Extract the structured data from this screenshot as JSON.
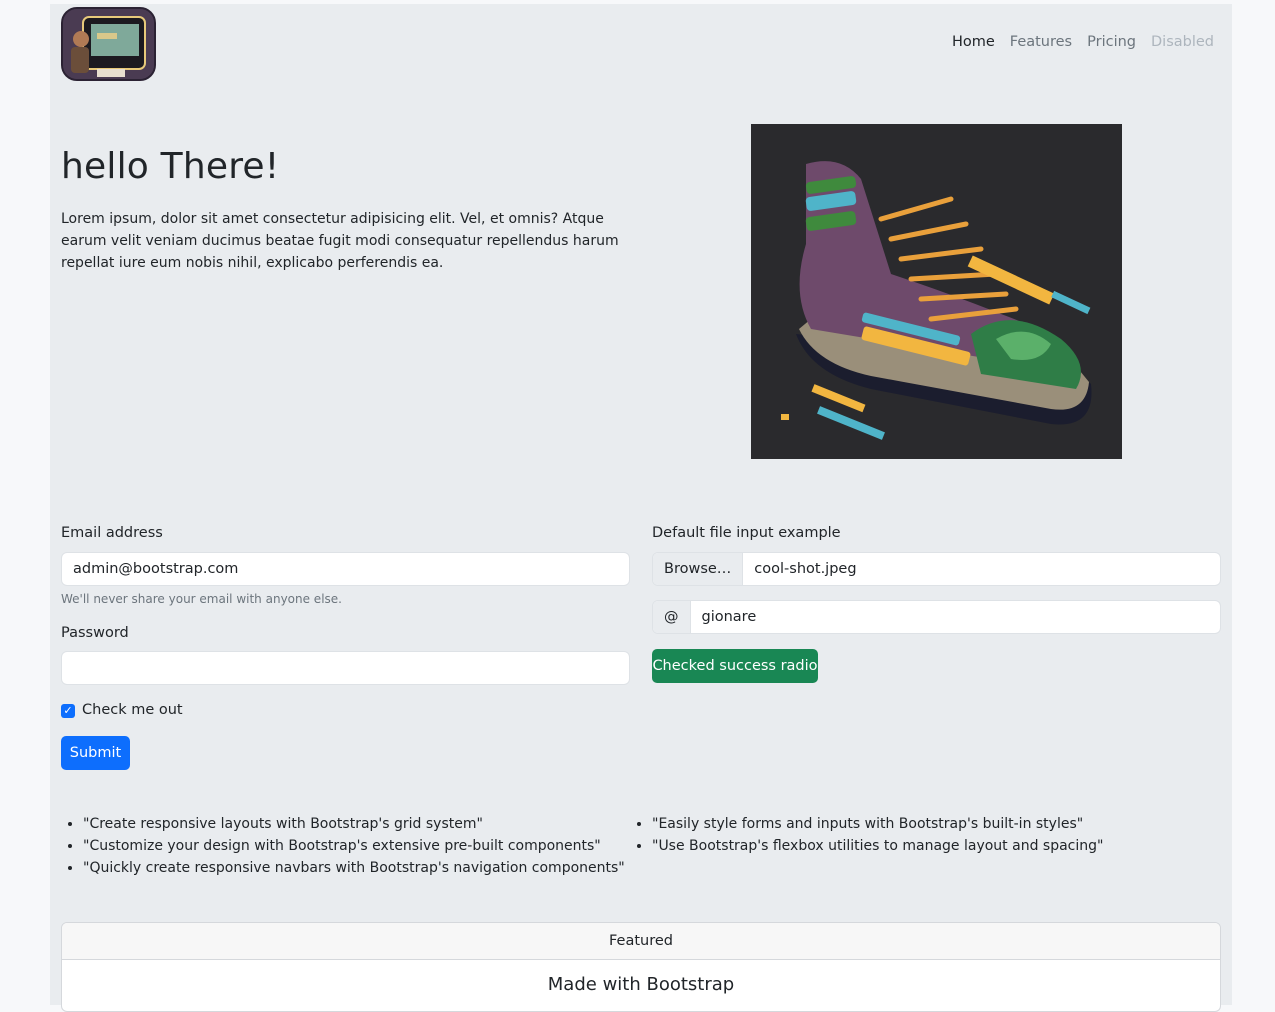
{
  "navbar": {
    "links": [
      {
        "label": "Home",
        "state": "active"
      },
      {
        "label": "Features",
        "state": "normal"
      },
      {
        "label": "Pricing",
        "state": "normal"
      },
      {
        "label": "Disabled",
        "state": "disabled"
      }
    ]
  },
  "hero": {
    "title": "hello There!",
    "text": "Lorem ipsum, dolor sit amet consectetur adipisicing elit. Vel, et omnis? Atque earum velit veniam ducimus beatae fugit modi consequatur repellendus harum repellat iure eum nobis nihil, explicabo perferendis ea."
  },
  "form": {
    "email_label": "Email address",
    "email_value": "admin@bootstrap.com",
    "email_help": "We'll never share your email with anyone else.",
    "password_label": "Password",
    "password_value": "",
    "checkbox_label": "Check me out",
    "checkbox_checked": true,
    "submit_label": "Submit"
  },
  "right_form": {
    "file_label": "Default file input example",
    "file_button": "Browse…",
    "file_value": "cool-shot.jpeg",
    "at_addon": "@",
    "username_value": "gionare",
    "success_button": "Checked success radio"
  },
  "lists": {
    "left": [
      "\"Create responsive layouts with Bootstrap's grid system\"",
      "\"Customize your design with Bootstrap's extensive pre-built components\"",
      "\"Quickly create responsive navbars with Bootstrap's navigation components\""
    ],
    "right": [
      "\"Easily style forms and inputs with Bootstrap's built-in styles\"",
      "\"Use Bootstrap's flexbox utilities to manage layout and spacing\""
    ]
  },
  "card": {
    "header": "Featured",
    "title": "Made with Bootstrap"
  },
  "colors": {
    "primary": "#0d6efd",
    "success": "#198754",
    "background": "#e9ecef"
  }
}
